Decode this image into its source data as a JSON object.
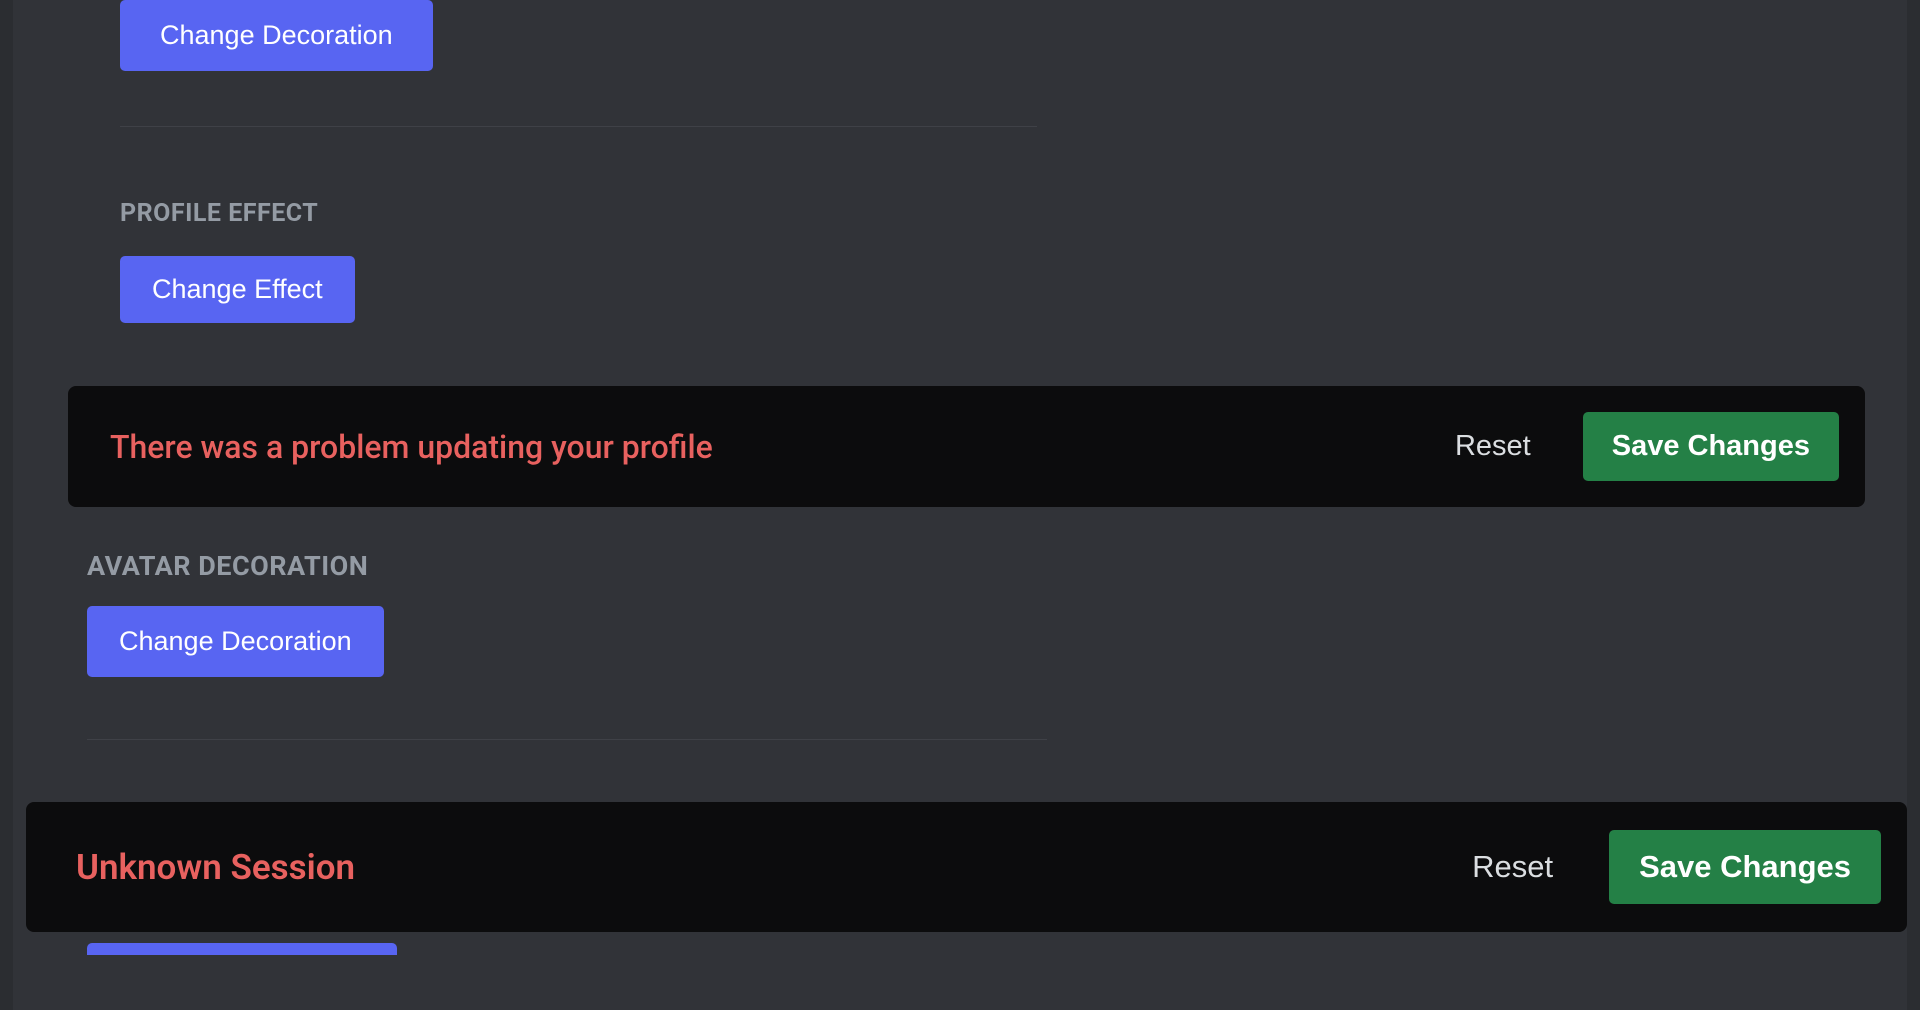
{
  "sections": {
    "decoration_top": {
      "button_label": "Change Decoration"
    },
    "profile_effect": {
      "header": "PROFILE EFFECT",
      "button_label": "Change Effect"
    },
    "avatar_decoration": {
      "header": "AVATAR DECORATION",
      "button_label": "Change Decoration"
    }
  },
  "toasts": {
    "error_profile": {
      "message": "There was a problem updating your profile",
      "reset_label": "Reset",
      "save_label": "Save Changes"
    },
    "unknown_session": {
      "message": "Unknown Session",
      "reset_label": "Reset",
      "save_label": "Save Changes"
    }
  }
}
